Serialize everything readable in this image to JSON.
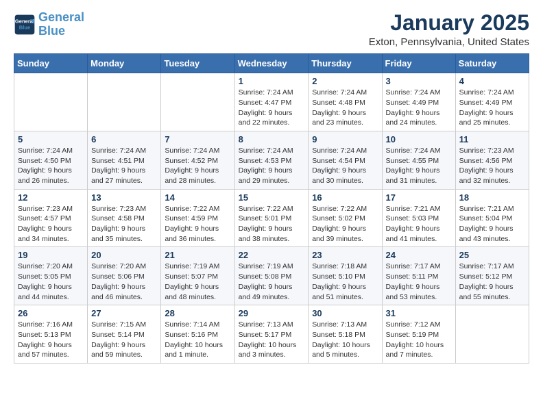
{
  "logo": {
    "line1": "General",
    "line2": "Blue"
  },
  "title": "January 2025",
  "location": "Exton, Pennsylvania, United States",
  "days_of_week": [
    "Sunday",
    "Monday",
    "Tuesday",
    "Wednesday",
    "Thursday",
    "Friday",
    "Saturday"
  ],
  "weeks": [
    [
      {
        "day": "",
        "info": ""
      },
      {
        "day": "",
        "info": ""
      },
      {
        "day": "",
        "info": ""
      },
      {
        "day": "1",
        "info": "Sunrise: 7:24 AM\nSunset: 4:47 PM\nDaylight: 9 hours and 22 minutes."
      },
      {
        "day": "2",
        "info": "Sunrise: 7:24 AM\nSunset: 4:48 PM\nDaylight: 9 hours and 23 minutes."
      },
      {
        "day": "3",
        "info": "Sunrise: 7:24 AM\nSunset: 4:49 PM\nDaylight: 9 hours and 24 minutes."
      },
      {
        "day": "4",
        "info": "Sunrise: 7:24 AM\nSunset: 4:49 PM\nDaylight: 9 hours and 25 minutes."
      }
    ],
    [
      {
        "day": "5",
        "info": "Sunrise: 7:24 AM\nSunset: 4:50 PM\nDaylight: 9 hours and 26 minutes."
      },
      {
        "day": "6",
        "info": "Sunrise: 7:24 AM\nSunset: 4:51 PM\nDaylight: 9 hours and 27 minutes."
      },
      {
        "day": "7",
        "info": "Sunrise: 7:24 AM\nSunset: 4:52 PM\nDaylight: 9 hours and 28 minutes."
      },
      {
        "day": "8",
        "info": "Sunrise: 7:24 AM\nSunset: 4:53 PM\nDaylight: 9 hours and 29 minutes."
      },
      {
        "day": "9",
        "info": "Sunrise: 7:24 AM\nSunset: 4:54 PM\nDaylight: 9 hours and 30 minutes."
      },
      {
        "day": "10",
        "info": "Sunrise: 7:24 AM\nSunset: 4:55 PM\nDaylight: 9 hours and 31 minutes."
      },
      {
        "day": "11",
        "info": "Sunrise: 7:23 AM\nSunset: 4:56 PM\nDaylight: 9 hours and 32 minutes."
      }
    ],
    [
      {
        "day": "12",
        "info": "Sunrise: 7:23 AM\nSunset: 4:57 PM\nDaylight: 9 hours and 34 minutes."
      },
      {
        "day": "13",
        "info": "Sunrise: 7:23 AM\nSunset: 4:58 PM\nDaylight: 9 hours and 35 minutes."
      },
      {
        "day": "14",
        "info": "Sunrise: 7:22 AM\nSunset: 4:59 PM\nDaylight: 9 hours and 36 minutes."
      },
      {
        "day": "15",
        "info": "Sunrise: 7:22 AM\nSunset: 5:01 PM\nDaylight: 9 hours and 38 minutes."
      },
      {
        "day": "16",
        "info": "Sunrise: 7:22 AM\nSunset: 5:02 PM\nDaylight: 9 hours and 39 minutes."
      },
      {
        "day": "17",
        "info": "Sunrise: 7:21 AM\nSunset: 5:03 PM\nDaylight: 9 hours and 41 minutes."
      },
      {
        "day": "18",
        "info": "Sunrise: 7:21 AM\nSunset: 5:04 PM\nDaylight: 9 hours and 43 minutes."
      }
    ],
    [
      {
        "day": "19",
        "info": "Sunrise: 7:20 AM\nSunset: 5:05 PM\nDaylight: 9 hours and 44 minutes."
      },
      {
        "day": "20",
        "info": "Sunrise: 7:20 AM\nSunset: 5:06 PM\nDaylight: 9 hours and 46 minutes."
      },
      {
        "day": "21",
        "info": "Sunrise: 7:19 AM\nSunset: 5:07 PM\nDaylight: 9 hours and 48 minutes."
      },
      {
        "day": "22",
        "info": "Sunrise: 7:19 AM\nSunset: 5:08 PM\nDaylight: 9 hours and 49 minutes."
      },
      {
        "day": "23",
        "info": "Sunrise: 7:18 AM\nSunset: 5:10 PM\nDaylight: 9 hours and 51 minutes."
      },
      {
        "day": "24",
        "info": "Sunrise: 7:17 AM\nSunset: 5:11 PM\nDaylight: 9 hours and 53 minutes."
      },
      {
        "day": "25",
        "info": "Sunrise: 7:17 AM\nSunset: 5:12 PM\nDaylight: 9 hours and 55 minutes."
      }
    ],
    [
      {
        "day": "26",
        "info": "Sunrise: 7:16 AM\nSunset: 5:13 PM\nDaylight: 9 hours and 57 minutes."
      },
      {
        "day": "27",
        "info": "Sunrise: 7:15 AM\nSunset: 5:14 PM\nDaylight: 9 hours and 59 minutes."
      },
      {
        "day": "28",
        "info": "Sunrise: 7:14 AM\nSunset: 5:16 PM\nDaylight: 10 hours and 1 minute."
      },
      {
        "day": "29",
        "info": "Sunrise: 7:13 AM\nSunset: 5:17 PM\nDaylight: 10 hours and 3 minutes."
      },
      {
        "day": "30",
        "info": "Sunrise: 7:13 AM\nSunset: 5:18 PM\nDaylight: 10 hours and 5 minutes."
      },
      {
        "day": "31",
        "info": "Sunrise: 7:12 AM\nSunset: 5:19 PM\nDaylight: 10 hours and 7 minutes."
      },
      {
        "day": "",
        "info": ""
      }
    ]
  ]
}
